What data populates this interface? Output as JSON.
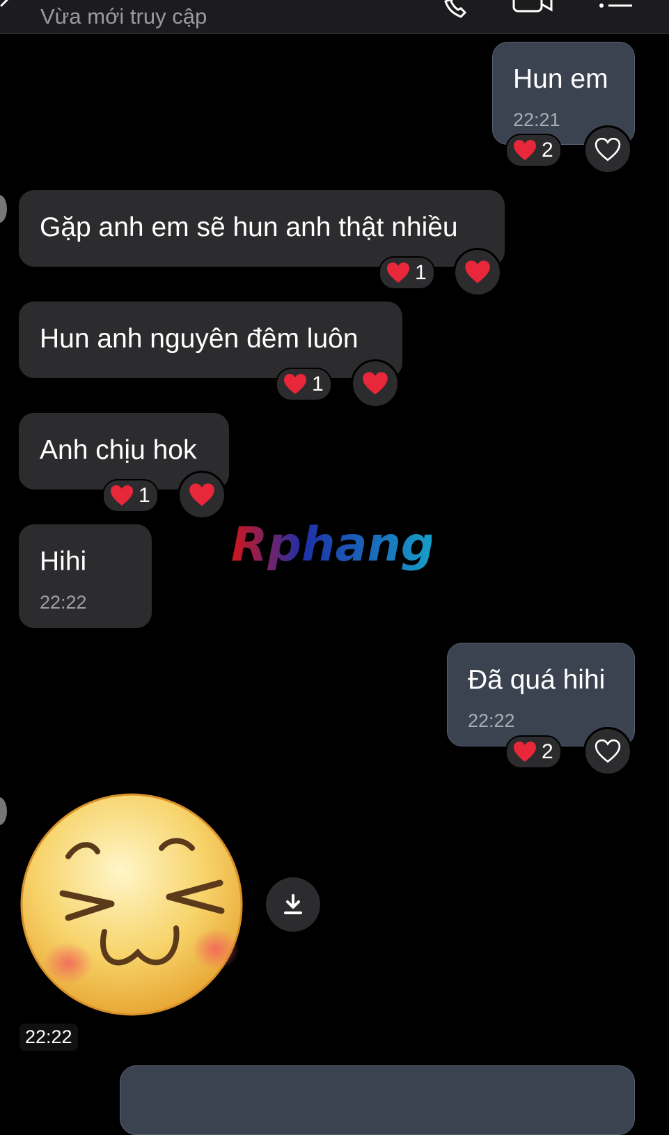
{
  "header": {
    "subtitle": "Vừa mới truy cập"
  },
  "messages": [
    {
      "text": "Hun em",
      "time": "22:21",
      "reaction_count": "2"
    },
    {
      "text": "Gặp anh em sẽ hun anh thật nhiều",
      "reaction_count": "1"
    },
    {
      "text": "Hun anh nguyên đêm luôn",
      "reaction_count": "1"
    },
    {
      "text": "Anh chịu hok",
      "reaction_count": "1"
    },
    {
      "text": "Hihi",
      "time": "22:22"
    },
    {
      "text": "Đã quá hihi",
      "time": "22:22",
      "reaction_count": "2"
    }
  ],
  "sticker": {
    "time": "22:22"
  },
  "watermark": {
    "text": "Rphang"
  },
  "colors": {
    "heart": "#e8283a",
    "sent_bubble": "#3b4350",
    "recv_bubble": "#2c2c2e"
  }
}
